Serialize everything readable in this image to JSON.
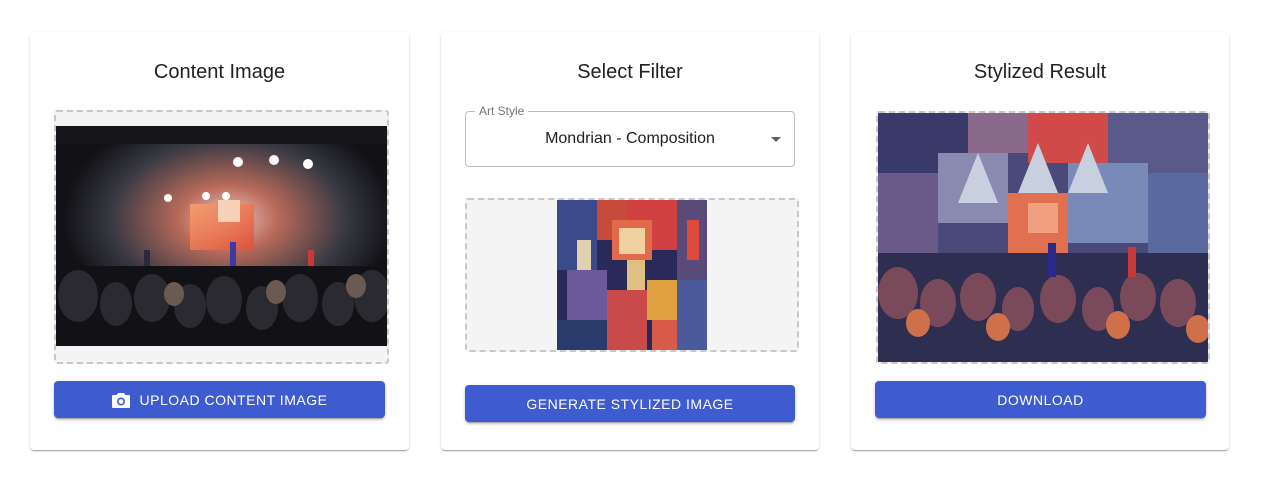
{
  "content_card": {
    "title": "Content Image",
    "upload_label": "Upload Content Image",
    "image_name": "concert-photo"
  },
  "filter_card": {
    "title": "Select Filter",
    "select_label": "Art Style",
    "selected_style": "Mondrian - Composition",
    "generate_label": "Generate Stylized Image",
    "image_name": "style-painting"
  },
  "result_card": {
    "title": "Stylized Result",
    "download_label": "Download",
    "image_name": "stylized-concert"
  },
  "colors": {
    "accent": "#3f5bd0",
    "dropzone_bg": "#f4f4f4",
    "dropzone_border": "#c8c8c8"
  }
}
